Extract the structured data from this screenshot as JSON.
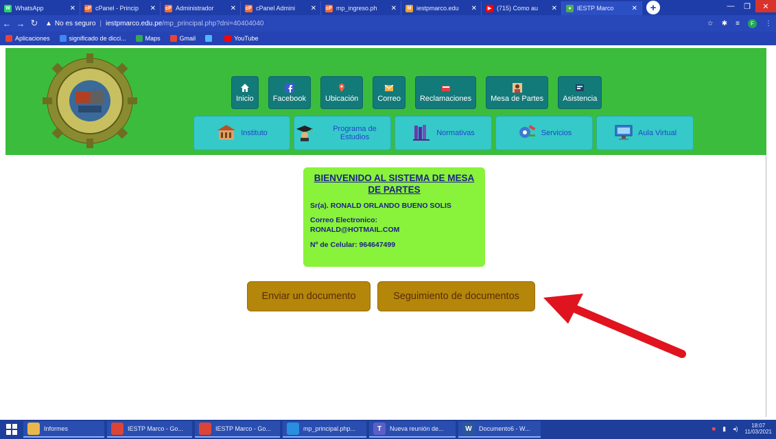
{
  "browser": {
    "tabs": [
      {
        "label": "WhatsApp",
        "color": "#25d366",
        "glyph": "W"
      },
      {
        "label": "cPanel - Princip",
        "color": "#ff6c2c",
        "glyph": "cP"
      },
      {
        "label": "Administrador",
        "color": "#ff6c2c",
        "glyph": "cP"
      },
      {
        "label": "cPanel Admini",
        "color": "#ff6c2c",
        "glyph": "cP"
      },
      {
        "label": "mp_ingreso.ph",
        "color": "#ff6c2c",
        "glyph": "cP"
      },
      {
        "label": "iestpmarco.edu",
        "color": "#f0a030",
        "glyph": "M"
      },
      {
        "label": "(715) Como au",
        "color": "#ff0000",
        "glyph": "▶"
      },
      {
        "label": "IESTP Marco",
        "color": "#4caf50",
        "glyph": "●"
      }
    ],
    "new_tab": "+",
    "url_warning": "No es seguro",
    "url_domain": "iestpmarco.edu.pe",
    "url_path": "/mp_principal.php?dni=40404040",
    "profile_initial": "F"
  },
  "bookmarks": [
    {
      "label": "Aplicaciones",
      "color": "#e94235"
    },
    {
      "label": "significado de dicci...",
      "color": "#4285f4"
    },
    {
      "label": "Maps",
      "color": "#34a853"
    },
    {
      "label": "Gmail",
      "color": "#ea4335"
    },
    {
      "label": "",
      "color": "#4fb6ff"
    },
    {
      "label": "YouTube",
      "color": "#ff0000"
    }
  ],
  "site": {
    "top_nav": [
      {
        "label": "Inicio",
        "icon": "home-icon"
      },
      {
        "label": "Facebook",
        "icon": "facebook-icon"
      },
      {
        "label": "Ubicación",
        "icon": "location-pin-icon"
      },
      {
        "label": "Correo",
        "icon": "mail-icon"
      },
      {
        "label": "Reclamaciones",
        "icon": "complaint-book-icon"
      },
      {
        "label": "Mesa de Partes",
        "icon": "person-icon"
      },
      {
        "label": "Asistencia",
        "icon": "attendance-icon"
      }
    ],
    "sub_nav": [
      {
        "label": "Instituto",
        "icon": "building-icon"
      },
      {
        "label": "Programa de Estudios",
        "icon": "graduate-icon"
      },
      {
        "label": "Normativas",
        "icon": "books-icon"
      },
      {
        "label": "Servicios",
        "icon": "services-icon"
      },
      {
        "label": "Aula Virtual",
        "icon": "computer-icon"
      }
    ]
  },
  "welcome": {
    "title": "BIENVENIDO AL SISTEMA DE MESA DE PARTES",
    "name": "Sr(a). RONALD ORLANDO BUENO SOLIS",
    "email_label": "Correo Electronico:",
    "email": "RONALD@HOTMAIL.COM",
    "phone": "Nº de Celular: 964647499"
  },
  "actions": {
    "send": "Enviar un documento",
    "track": "Seguimiento de documentos"
  },
  "taskbar": {
    "items": [
      {
        "label": "Informes",
        "color": "#e8b84a",
        "glyph": ""
      },
      {
        "label": "IESTP Marco - Go...",
        "color": "#db4437",
        "glyph": ""
      },
      {
        "label": "IESTP Marco - Go...",
        "color": "#db4437",
        "glyph": ""
      },
      {
        "label": "mp_principal.php...",
        "color": "#2a8fe0",
        "glyph": ""
      },
      {
        "label": "Nueva reunión de...",
        "color": "#5b5fc7",
        "glyph": "T"
      },
      {
        "label": "Documento6 - W...",
        "color": "#2b579a",
        "glyph": "W"
      }
    ],
    "time": "18:07",
    "date": "11/03/2021"
  }
}
